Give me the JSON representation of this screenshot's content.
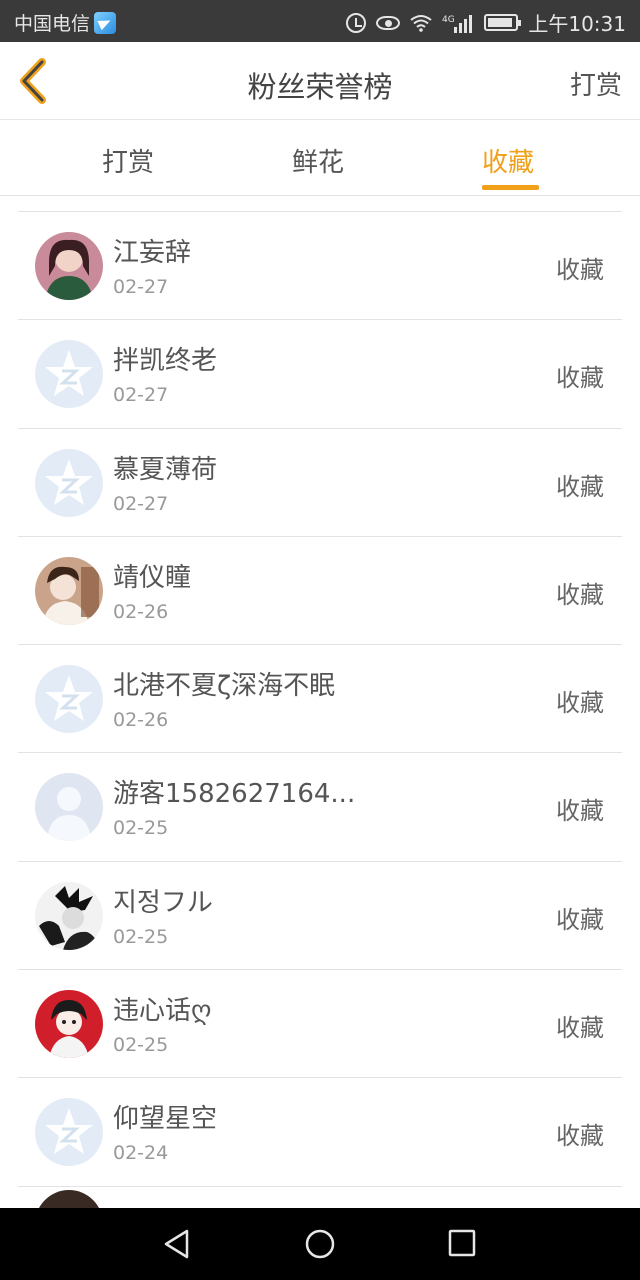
{
  "status_bar": {
    "carrier": "中国电信",
    "network": "4G",
    "time": "上午10:31"
  },
  "header": {
    "title": "粉丝荣誉榜",
    "right_action": "打赏",
    "back_icon": "chevron-left-icon",
    "accent_color": "#f0a019"
  },
  "tabs": [
    {
      "label": "打赏",
      "active": false
    },
    {
      "label": "鲜花",
      "active": false
    },
    {
      "label": "收藏",
      "active": true
    }
  ],
  "list": {
    "items": [
      {
        "name": "江妄辞",
        "date": "02-27",
        "action": "收藏",
        "avatar": "photo-avatar"
      },
      {
        "name": "拌凯终老",
        "date": "02-27",
        "action": "收藏",
        "avatar": "qzone-default-avatar"
      },
      {
        "name": "慕夏薄荷",
        "date": "02-27",
        "action": "收藏",
        "avatar": "qzone-default-avatar"
      },
      {
        "name": "靖仪瞳",
        "date": "02-26",
        "action": "收藏",
        "avatar": "photo-avatar"
      },
      {
        "name": "北港不夏ζ深海不眠",
        "date": "02-26",
        "action": "收藏",
        "avatar": "qzone-default-avatar"
      },
      {
        "name": "游客1582627164...",
        "date": "02-25",
        "action": "收藏",
        "avatar": "guest-default-avatar"
      },
      {
        "name": "지정フル",
        "date": "02-25",
        "action": "收藏",
        "avatar": "photo-avatar"
      },
      {
        "name": "违心话ღ",
        "date": "02-25",
        "action": "收藏",
        "avatar": "photo-avatar"
      },
      {
        "name": "仰望星空",
        "date": "02-24",
        "action": "收藏",
        "avatar": "qzone-default-avatar"
      }
    ]
  },
  "nav_bar": {
    "back": "nav-back-icon",
    "home": "nav-home-icon",
    "recent": "nav-recent-icon"
  }
}
